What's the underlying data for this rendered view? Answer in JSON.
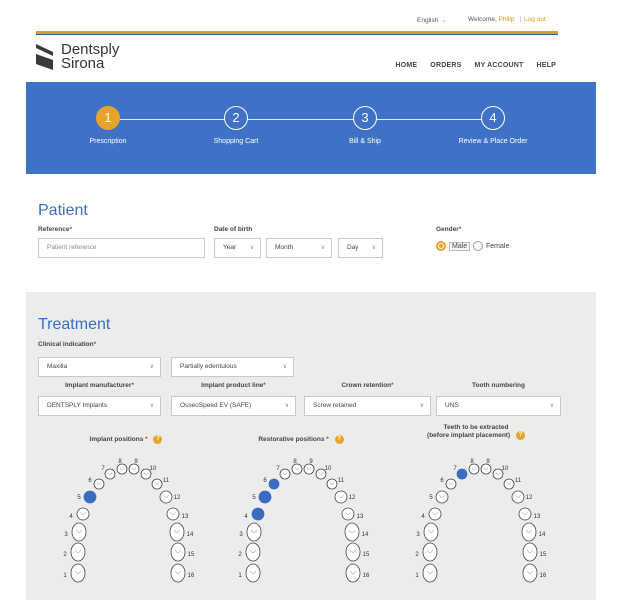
{
  "utility": {
    "language": "English",
    "welcome_prefix": "Welcome,",
    "user_name": "Philip",
    "separator": "|",
    "logout": "Log out"
  },
  "brand": {
    "line1": "Dentsply",
    "line2": "Sirona"
  },
  "nav": {
    "home": "HOME",
    "orders": "ORDERS",
    "my_account": "MY ACCOUNT",
    "help": "HELP"
  },
  "steps": [
    {
      "number": "1",
      "label": "Prescription",
      "active": true
    },
    {
      "number": "2",
      "label": "Shopping Cart",
      "active": false
    },
    {
      "number": "3",
      "label": "Bill & Ship",
      "active": false
    },
    {
      "number": "4",
      "label": "Review & Place Order",
      "active": false
    }
  ],
  "patient": {
    "title": "Patient",
    "reference_label": "Reference",
    "reference_placeholder": "Patient reference",
    "dob_label": "Date of birth",
    "year": "Year",
    "month": "Month",
    "day": "Day",
    "gender_label": "Gender",
    "male": "Male",
    "female": "Female",
    "selected_gender": "Male",
    "required_mark": "*"
  },
  "treatment": {
    "title": "Treatment",
    "clinical_indication_label": "Clinical indication",
    "jaw": "Maxilla",
    "edentulous": "Partially edentulous",
    "manufacturer_label": "Implant manufacturer",
    "manufacturer_value": "DENTSPLY Implants",
    "product_line_label": "Implant product line",
    "product_line_value": "OsseoSpeed EV (SAFE)",
    "crown_label": "Crown retention",
    "crown_value": "Screw retained",
    "numbering_label": "Tooth numbering",
    "numbering_value": "UNS",
    "required_mark": "*"
  },
  "charts": [
    {
      "title": "Implant positions",
      "required": true,
      "help": "?",
      "selected_teeth": [
        5
      ]
    },
    {
      "title": "Restorative positions",
      "required": true,
      "help": "?",
      "selected_teeth": [
        4,
        5,
        6
      ]
    },
    {
      "title_line1": "Teeth to be extracted",
      "title_line2": "(before implant placement)",
      "required": false,
      "help": "?",
      "selected_teeth": [
        7
      ]
    }
  ],
  "tooth_numbers": [
    "1",
    "2",
    "3",
    "4",
    "5",
    "6",
    "7",
    "8",
    "9",
    "10",
    "11",
    "12",
    "13",
    "14",
    "15",
    "16"
  ],
  "colors": {
    "accent": "#e8a32a",
    "brand_blue": "#3f72c6",
    "selected_tooth": "#3b6dbf"
  }
}
